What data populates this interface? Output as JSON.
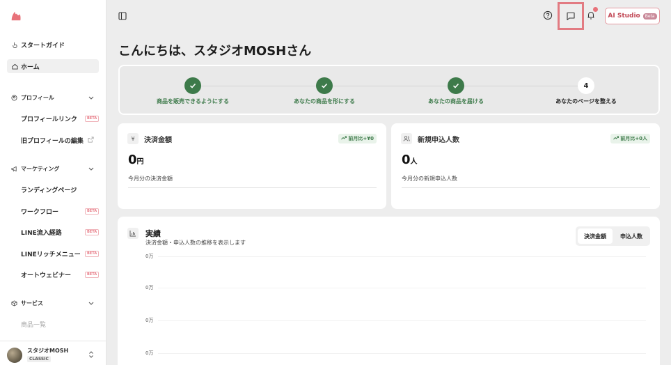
{
  "sidebar": {
    "guide": "スタートガイド",
    "home": "ホーム",
    "profile_section": "プロフィール",
    "profile_items": [
      {
        "label": "プロフィールリンク",
        "badge": "BETA"
      },
      {
        "label": "旧プロフィールの編集",
        "external": true
      }
    ],
    "marketing_section": "マーケティング",
    "marketing_items": [
      {
        "label": "ランディングページ"
      },
      {
        "label": "ワークフロー",
        "badge": "BETA"
      },
      {
        "label": "LINE流入経路",
        "badge": "BETA"
      },
      {
        "label": "LINEリッチメニュー",
        "badge": "BETA"
      },
      {
        "label": "オートウェビナー",
        "badge": "BETA"
      }
    ],
    "service_section": "サービス",
    "service_items": [
      {
        "label": "商品一覧"
      }
    ],
    "user": {
      "name": "スタジオMOSH",
      "plan": "CLASSIC"
    }
  },
  "topbar": {
    "ai_studio": "AI Studio",
    "ai_badge": "Beta",
    "icons": [
      "collapse-sidebar-icon",
      "help-icon",
      "chat-icon",
      "bell-icon"
    ],
    "highlight_color": "#e27b82"
  },
  "main": {
    "greeting": "こんにちは、スタジオMOSHさん",
    "steps": [
      {
        "label": "商品を販売できるようにする",
        "done": true
      },
      {
        "label": "あなたの商品を形にする",
        "done": true
      },
      {
        "label": "あなたの商品を届ける",
        "done": true
      },
      {
        "label": "あなたのページを整える",
        "number": "4",
        "done": false
      }
    ],
    "cards": [
      {
        "icon": "¥",
        "title": "決済金額",
        "badge": "前月比+¥0",
        "value": "0",
        "unit": "円",
        "sub": "今月分の決済金額"
      },
      {
        "icon": "users",
        "title": "新規申込人数",
        "badge": "前月比+0人",
        "value": "0",
        "unit": "人",
        "sub": "今月分の新規申込人数"
      }
    ],
    "performance": {
      "title": "実績",
      "subtitle": "決済金額・申込人数の推移を表示します",
      "tab_active": "決済金額",
      "tab_other": "申込人数",
      "yticks": [
        "0万",
        "0万",
        "0万",
        "0万"
      ]
    }
  },
  "colors": {
    "accent": "#3d7a4a",
    "brand": "#e8727a"
  }
}
